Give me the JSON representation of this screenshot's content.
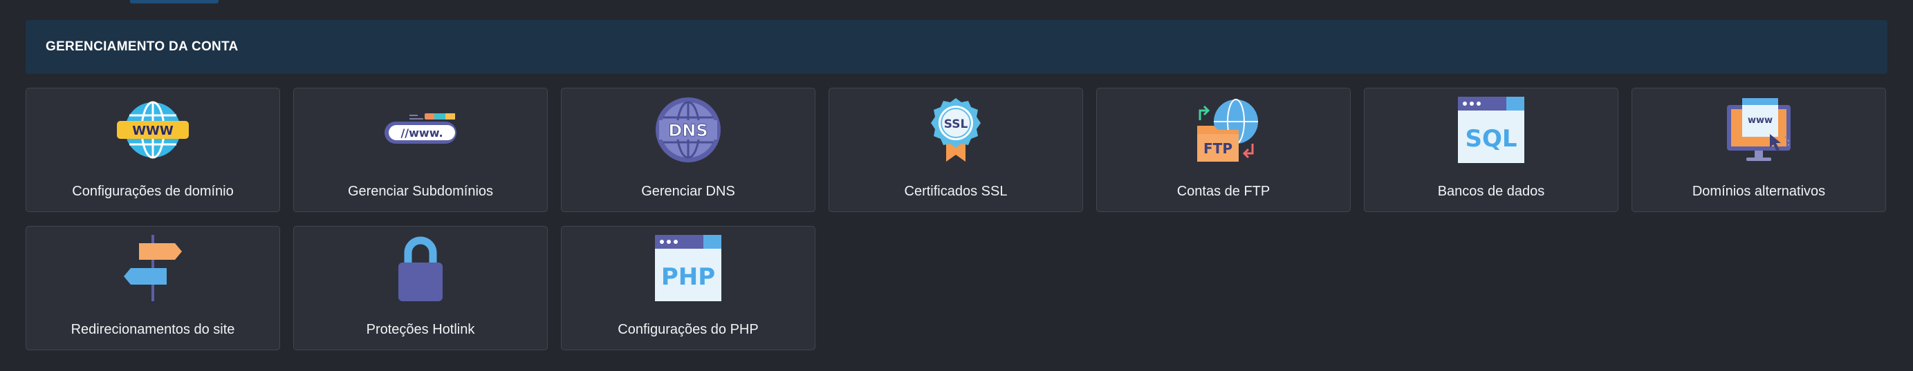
{
  "header": {
    "title": "GERENCIAMENTO DA CONTA"
  },
  "tiles": [
    {
      "label": "Configurações de domínio",
      "icon": "globe-www-icon",
      "icon_text": "WWW"
    },
    {
      "label": "Gerenciar Subdomínios",
      "icon": "url-bar-icon",
      "icon_text": "//www."
    },
    {
      "label": "Gerenciar DNS",
      "icon": "dns-globe-icon",
      "icon_text": "DNS"
    },
    {
      "label": "Certificados SSL",
      "icon": "ssl-badge-icon",
      "icon_text": "SSL"
    },
    {
      "label": "Contas de FTP",
      "icon": "ftp-folder-icon",
      "icon_text": "FTP"
    },
    {
      "label": "Bancos de dados",
      "icon": "sql-window-icon",
      "icon_text": "SQL"
    },
    {
      "label": "Domínios alternativos",
      "icon": "monitor-www-icon",
      "icon_text": "www"
    },
    {
      "label": "Redirecionamentos do site",
      "icon": "signpost-icon"
    },
    {
      "label": "Proteções Hotlink",
      "icon": "padlock-icon"
    },
    {
      "label": "Configurações do PHP",
      "icon": "php-window-icon",
      "icon_text": "PHP"
    }
  ],
  "colors": {
    "background": "#25272e",
    "header_bg": "#1d3347",
    "tile_bg": "#2d3039",
    "tile_border": "#41454f"
  }
}
